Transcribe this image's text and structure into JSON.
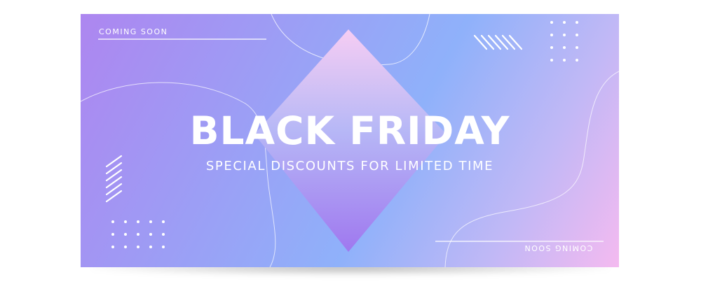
{
  "banner": {
    "top_tag": "COMING SOON",
    "bottom_tag": "COMING SOON",
    "headline": "BLACK FRIDAY",
    "subheadline": "SPECIAL DISCOUNTS FOR LIMITED TIME"
  },
  "colors": {
    "gradient_start": "#ad86f0",
    "gradient_mid": "#8fb1fa",
    "gradient_end": "#f4baf0",
    "diamond_top": "#f4c8f2",
    "diamond_bottom": "#a07ef0",
    "text": "#ffffff"
  }
}
